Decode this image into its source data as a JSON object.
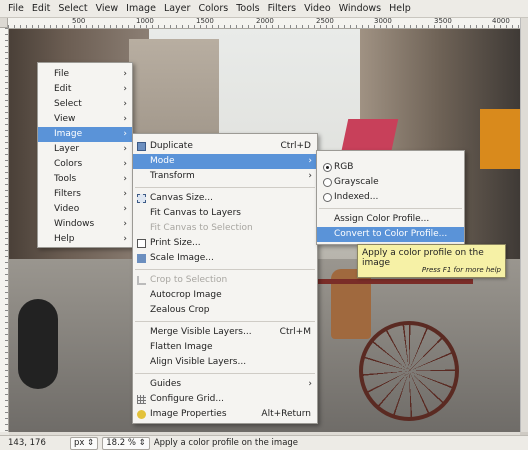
{
  "menubar": {
    "items": [
      "File",
      "Edit",
      "Select",
      "View",
      "Image",
      "Layer",
      "Colors",
      "Tools",
      "Filters",
      "Video",
      "Windows",
      "Help"
    ]
  },
  "ruler": {
    "ticks": [
      "500",
      "1000",
      "1500",
      "2000",
      "2500",
      "3000",
      "3500",
      "4000"
    ]
  },
  "context_menu": {
    "items": [
      {
        "label": "File",
        "submenu": true
      },
      {
        "label": "Edit",
        "submenu": true
      },
      {
        "label": "Select",
        "submenu": true
      },
      {
        "label": "View",
        "submenu": true
      },
      {
        "label": "Image",
        "submenu": true,
        "highlighted": true
      },
      {
        "label": "Layer",
        "submenu": true
      },
      {
        "label": "Colors",
        "submenu": true
      },
      {
        "label": "Tools",
        "submenu": true
      },
      {
        "label": "Filters",
        "submenu": true
      },
      {
        "label": "Video",
        "submenu": true
      },
      {
        "label": "Windows",
        "submenu": true
      },
      {
        "label": "Help",
        "submenu": true
      }
    ]
  },
  "image_menu": {
    "duplicate": {
      "label": "Duplicate",
      "shortcut": "Ctrl+D"
    },
    "mode": {
      "label": "Mode"
    },
    "transform": {
      "label": "Transform"
    },
    "canvas_size": {
      "label": "Canvas Size..."
    },
    "fit_canvas_layers": {
      "label": "Fit Canvas to Layers"
    },
    "fit_canvas_selection": {
      "label": "Fit Canvas to Selection"
    },
    "print_size": {
      "label": "Print Size..."
    },
    "scale_image": {
      "label": "Scale Image..."
    },
    "crop_selection": {
      "label": "Crop to Selection"
    },
    "autocrop": {
      "label": "Autocrop Image"
    },
    "zealous_crop": {
      "label": "Zealous Crop"
    },
    "merge_visible": {
      "label": "Merge Visible Layers...",
      "shortcut": "Ctrl+M"
    },
    "flatten": {
      "label": "Flatten Image"
    },
    "align_visible": {
      "label": "Align Visible Layers..."
    },
    "guides": {
      "label": "Guides"
    },
    "configure_grid": {
      "label": "Configure Grid..."
    },
    "image_properties": {
      "label": "Image Properties",
      "shortcut": "Alt+Return"
    }
  },
  "mode_menu": {
    "rgb": {
      "label": "RGB",
      "selected": true
    },
    "grayscale": {
      "label": "Grayscale"
    },
    "indexed": {
      "label": "Indexed..."
    },
    "assign_profile": {
      "label": "Assign Color Profile..."
    },
    "convert_profile": {
      "label": "Convert to Color Profile..."
    }
  },
  "tooltip": {
    "text": "Apply a color profile on the image",
    "help": "Press F1 for more help"
  },
  "statusbar": {
    "coords": "143, 176",
    "unit": "px",
    "zoom": "18.2 %",
    "message": "Apply a color profile on the image"
  },
  "colors": {
    "highlight": "#5a93d8",
    "tooltip_bg": "#f6f1a6",
    "menu_bg": "#f5f4f1"
  }
}
